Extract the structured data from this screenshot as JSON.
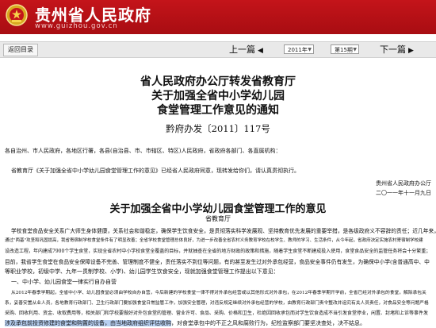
{
  "header": {
    "title": "贵州省人民政府",
    "url": "www.guizhou.gov.cn"
  },
  "nav": {
    "back_label": "返回目录",
    "prev_label": "上一篇",
    "next_label": "下一篇",
    "year": "2011年",
    "issue": "第15期"
  },
  "document": {
    "title_line1": "省人民政府办公厅转发省教育厅",
    "title_line2": "关于加强全省中小学幼儿园",
    "title_line3": "食堂管理工作意见的通知",
    "doc_number": "黔府办发〔2011〕117号",
    "addressee": "各自治州、市人民政府，各地区行署，各县(自治县、市、市辖区、特区)人民政府，省政府各部门、各直属机构：",
    "body_line1": "省教育厅《关于加强全省中小学幼儿园食堂管理工作的意见》已经省人民政府同意，现转发给你们，请认真贯彻执行。",
    "sign_org": "贵州省人民政府办公厅",
    "sign_date": "二〇一一年十一月九日",
    "opinion_title": "关于加强全省中小学幼儿园食堂管理工作的意见",
    "opinion_dept": "省教育厅",
    "para1_l1": "学校食堂食品安全关系广大师生身体健康，关系社会和谐稳定，确保学生饮食安全，是贯彻落实科学发展观、坚持教育优先发展的重要举措，是各级政府义不容辞的责任；近几年来，",
    "para1_l2": "通过\"两基\"攻坚和巩固提高，我省寄宿制学校食堂条件有了明显改善；全省学校食堂管理总体良好，为进一步改善全省农村义务教育学校在校学生、教师的学习、生活条件，从今年起，省政府决定实施农村寄宿制学校建",
    "para1_l3": "设改造工程，年内建成7900个学生食堂，实现全省农村中小学校食堂全覆盖的目标，并就抽查在全省的地方财政的政策和措施，随着学生食堂不断建成投入使用，食堂食品安全的监管任务将会十分繁重；",
    "para1_l4": "目前，我省学生食堂在食品安全保障设备不完善、管理制度不健全，责任落实不到位等问题，有的甚至发生过对外承包经营，食品安全事件仍有发生，为确保中小学(含普通高中、中",
    "para1_l5": "等职业学校，初级中学、九年一贯制学校、小学)、幼儿园学生饮食安全，现就加强食堂管理工作提出以下意见：",
    "section1": "一、中小学、幼儿园食堂一律实行自办自营",
    "para2_l1": "从2012年春季学期起，全省中小学、幼儿园食堂必须由学校自办自营，今后新建的学校食堂一律不得对外承包经营或以其他形式对外承包，在2012年春季学期开学前，全省已经对外承包的食堂，解除承包关",
    "para2_l2": "系，妥善安置从业人员，各地教育行政部门、卫生行政部门要加强食堂日常监管工作，加强安全管理，对违反规定继续对外承包经营的学校，由教育行政部门责令整改并追究有关人员责任，对食品安全等问题严格",
    "para2_l3": "采购、回收利用、资金、收取费用等，相关部门和学校要做好对外包食堂的管理、营业许可、食品、采购、价格和卫生，杜绝因回收承包而对学生饮食造成不当引发食堂停业，闲置、封堵和上诉等事件发",
    "para2_l4_hl": "涉及承包前投资修建的食堂和购置的设备，由当地政府组织评估收购",
    "para2_l4_rest": "，对食堂承包中的不正之风和腐败行为，纪检监察部门要坚决查处，决不姑息。"
  }
}
